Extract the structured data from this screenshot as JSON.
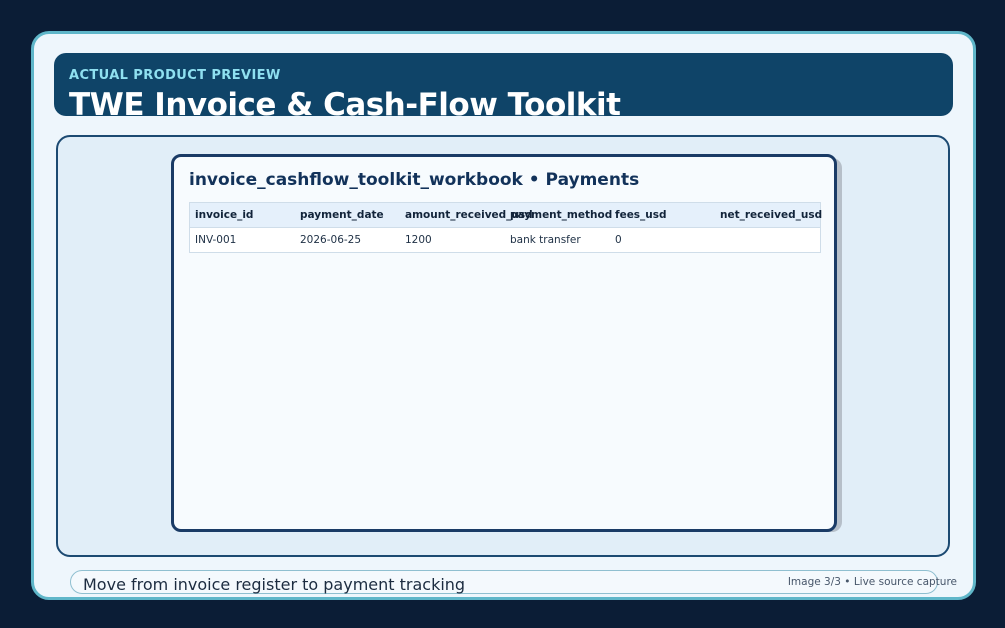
{
  "header": {
    "eyebrow": "ACTUAL PRODUCT PREVIEW",
    "title": "TWE Invoice & Cash-Flow Toolkit"
  },
  "sheet": {
    "title": "invoice_cashflow_toolkit_workbook • Payments",
    "columns": [
      "invoice_id",
      "payment_date",
      "amount_received_usd",
      "payment_method",
      "fees_usd",
      "net_received_usd"
    ],
    "rows": [
      [
        "INV-001",
        "2026-06-25",
        "1200",
        "bank transfer",
        "0",
        ""
      ]
    ]
  },
  "footer": {
    "caption": "Move from invoice register to payment tracking",
    "note": "Image 3/3 • Live source capture"
  }
}
